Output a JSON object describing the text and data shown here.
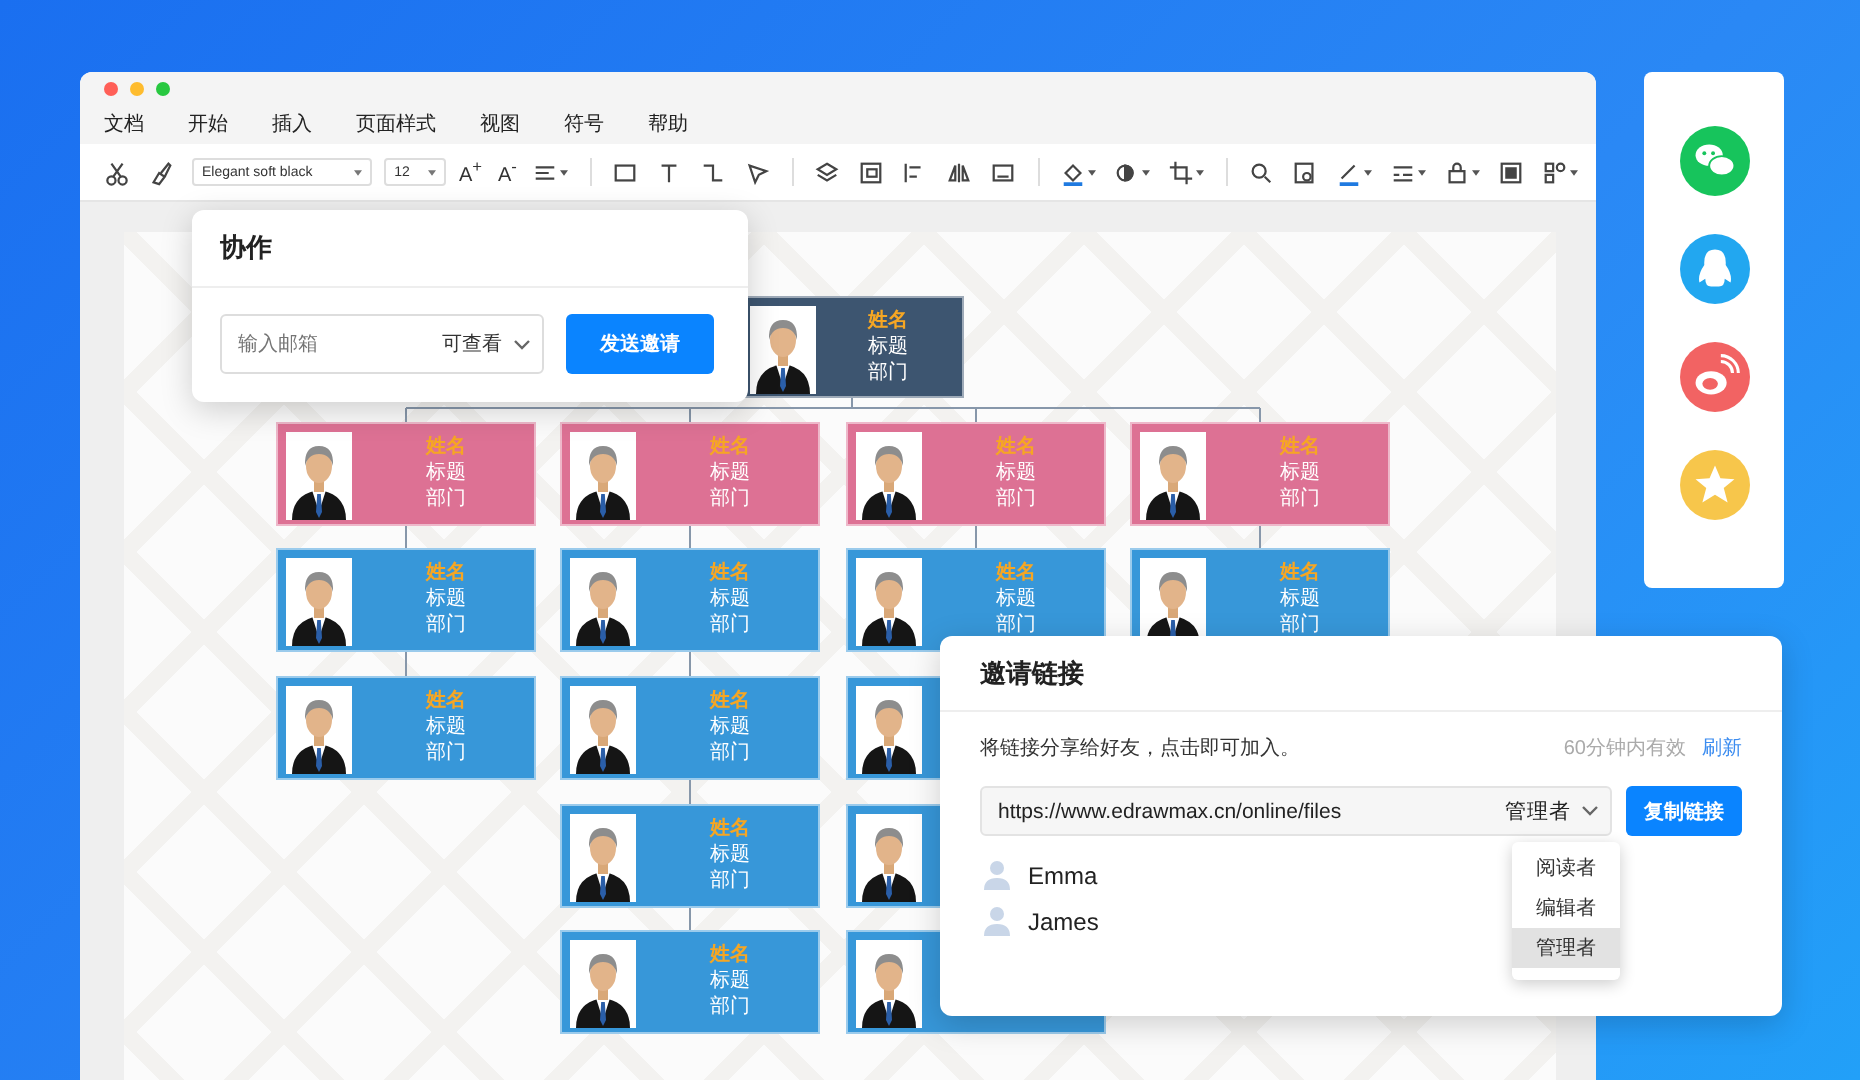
{
  "window": {
    "menu": [
      "文档",
      "开始",
      "插入",
      "页面样式",
      "视图",
      "符号",
      "帮助"
    ],
    "toolbar": {
      "font": "Elegant soft black",
      "size": "12",
      "grow_font": "A$^{+}$",
      "shrink_font": "A$^{-}$"
    }
  },
  "org_chart": {
    "root": {
      "name": "姓名",
      "title": "标题",
      "department": "部门"
    },
    "branches": [
      {
        "members": [
          {
            "kind": "lead",
            "name": "姓名",
            "title": "标题",
            "department": "部门"
          },
          {
            "kind": "staff",
            "name": "姓名",
            "title": "标题",
            "department": "部门"
          },
          {
            "kind": "staff",
            "name": "姓名",
            "title": "标题",
            "department": "部门"
          }
        ]
      },
      {
        "members": [
          {
            "kind": "lead",
            "name": "姓名",
            "title": "标题",
            "department": "部门"
          },
          {
            "kind": "staff",
            "name": "姓名",
            "title": "标题",
            "department": "部门"
          },
          {
            "kind": "staff",
            "name": "姓名",
            "title": "标题",
            "department": "部门"
          },
          {
            "kind": "staff",
            "name": "姓名",
            "title": "标题",
            "department": "部门"
          },
          {
            "kind": "staff",
            "name": "姓名",
            "title": "标题",
            "department": "部门"
          }
        ]
      },
      {
        "members": [
          {
            "kind": "lead",
            "name": "姓名",
            "title": "标题",
            "department": "部门"
          },
          {
            "kind": "staff",
            "name": "姓名",
            "title": "标题",
            "department": "部门"
          },
          {
            "kind": "covered"
          },
          {
            "kind": "covered"
          },
          {
            "kind": "covered"
          }
        ]
      },
      {
        "members": [
          {
            "kind": "lead",
            "name": "姓名",
            "title": "标题",
            "department": "部门"
          },
          {
            "kind": "staff",
            "name": "姓名",
            "title": "标题",
            "department": "部门"
          }
        ]
      }
    ]
  },
  "collab_dialog": {
    "title": "协作",
    "email_field": {
      "placeholder": "输入邮箱"
    },
    "permission": "可查看",
    "send_button": "发送邀请"
  },
  "invite_dialog": {
    "title": "邀请链接",
    "hint": "将链接分享给好友，点击即可加入。",
    "validity": "60分钟内有效",
    "refresh_link": "刷新",
    "link_field": {
      "value": "https://www.edrawmax.cn/online/files"
    },
    "role": "管理者",
    "copy_button": "复制链接",
    "users": [
      {
        "name": "Emma"
      },
      {
        "name": "James"
      }
    ],
    "role_menu": [
      {
        "label": "阅读者",
        "selected": false
      },
      {
        "label": "编辑者",
        "selected": false
      },
      {
        "label": "管理者",
        "selected": true
      }
    ]
  }
}
